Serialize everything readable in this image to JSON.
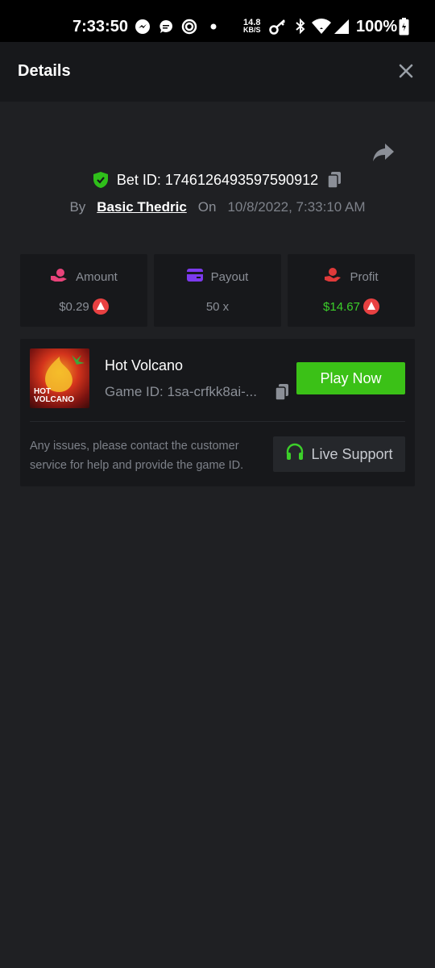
{
  "status_bar": {
    "time": "7:33:50",
    "speed_value": "14.8",
    "speed_unit": "KB/S",
    "battery": "100%",
    "icons": [
      "messenger-icon",
      "chat-icon",
      "sync-icon",
      "dot-icon",
      "key-icon",
      "bluetooth-icon",
      "wifi-icon",
      "signal-icon",
      "battery-icon"
    ]
  },
  "header": {
    "title": "Details",
    "close_icon": "close-icon"
  },
  "bet": {
    "bet_id": "Bet ID: 1746126493597590912",
    "by_label": "By",
    "user": "Basic Thedric",
    "on_label": "On",
    "date": "10/8/2022, 7:33:10 AM"
  },
  "stats": [
    {
      "label": "Amount",
      "value": "$0.29",
      "icon": "money-hand-icon",
      "color": "#e8437a",
      "currency_icon": "avax-coin-icon"
    },
    {
      "label": "Payout",
      "value": "50 x",
      "icon": "wallet-card-icon",
      "color": "#7c3aed"
    },
    {
      "label": "Profit",
      "value": "$14.67",
      "icon": "profit-hand-icon",
      "color": "#e03a3a",
      "value_color": "#3ccf2a",
      "currency_icon": "avax-coin-icon"
    }
  ],
  "game": {
    "name": "Hot Volcano",
    "game_id": "Game ID: 1sa-crfkk8ai-...",
    "thumbnail_line1": "HOT",
    "thumbnail_line2": "VOLCANO",
    "play_label": "Play Now",
    "issue_text": "Any issues, please contact the customer service for help and provide the game ID.",
    "support_label": "Live Support"
  },
  "colors": {
    "background": "#1f2023",
    "card": "#17181b",
    "accent_green": "#3bc117",
    "shield_green": "#2fbf1a",
    "avax_red": "#e84142"
  }
}
